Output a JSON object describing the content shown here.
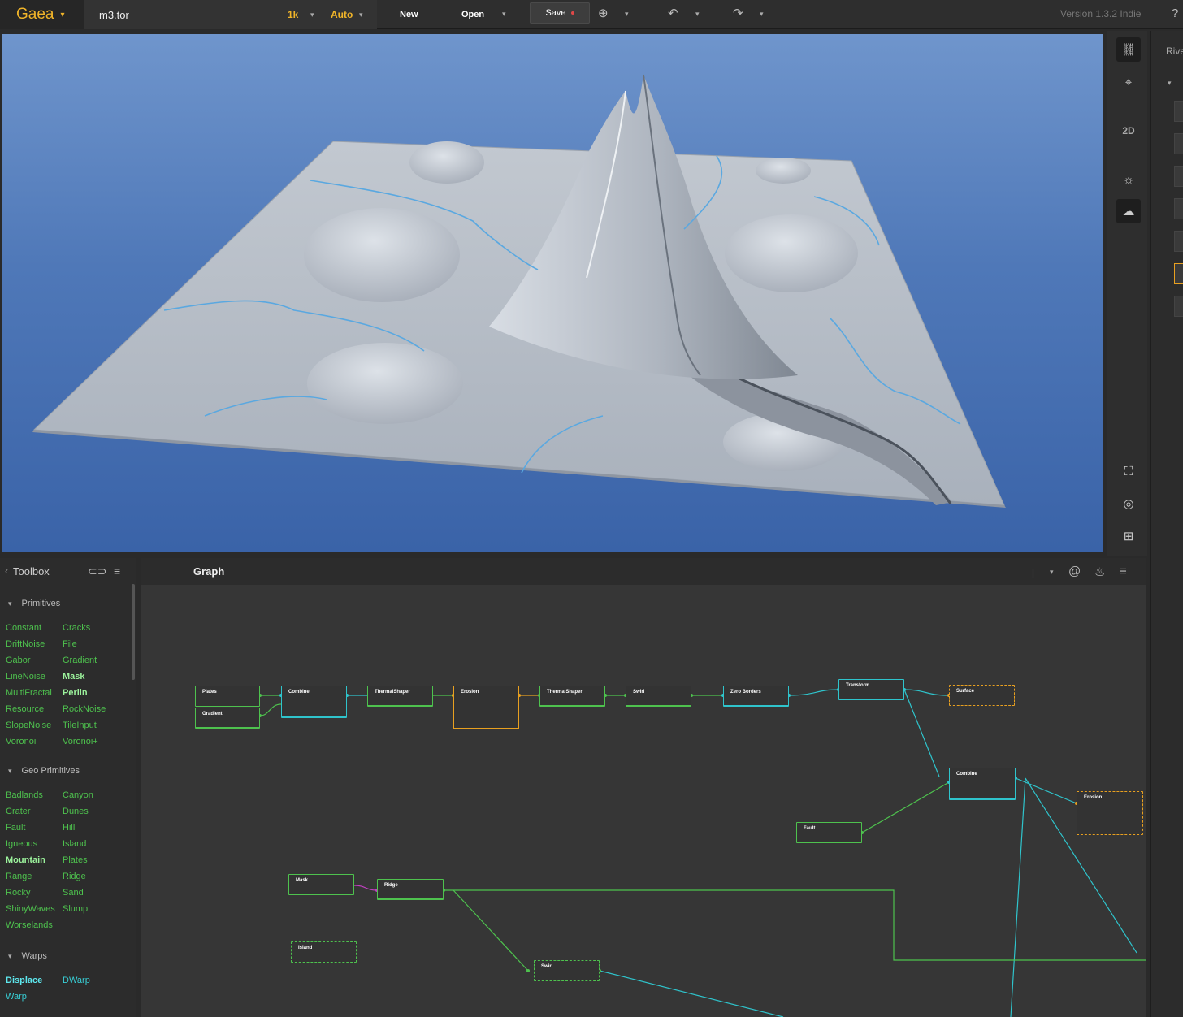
{
  "topbar": {
    "app_name": "Gaea",
    "file_name": "m3.tor",
    "resolution": "1k",
    "build_mode": "Auto",
    "new_label": "New",
    "open_label": "Open",
    "save_label": "Save",
    "version": "Version 1.3.2 Indie"
  },
  "viewport": {
    "view_toggle_label": "2D",
    "sky_color": "#5b82c0",
    "terrain_color": "#b4bcc6",
    "river_color": "#5aa8e0"
  },
  "right_panel": {
    "label": "Rive"
  },
  "toolbox": {
    "title": "Toolbox",
    "categories": [
      {
        "name": "Primitives",
        "items": [
          "Constant",
          "Cracks",
          "DriftNoise",
          "File",
          "Gabor",
          "Gradient",
          "LineNoise",
          "Mask",
          "MultiFractal",
          "Perlin",
          "Resource",
          "RockNoise",
          "SlopeNoise",
          "TileInput",
          "Voronoi",
          "Voronoi+"
        ]
      },
      {
        "name": "Geo Primitives",
        "items": [
          "Badlands",
          "Canyon",
          "Crater",
          "Dunes",
          "Fault",
          "Hill",
          "Igneous",
          "Island",
          "Mountain",
          "Plates",
          "Range",
          "Ridge",
          "Rocky",
          "Sand",
          "ShinyWaves",
          "Slump",
          "Worselands"
        ]
      },
      {
        "name": "Warps",
        "items": [
          "Displace",
          "DWarp",
          "Warp"
        ]
      }
    ],
    "highlighted": [
      "Mask",
      "Perlin",
      "Mountain",
      "Displace"
    ]
  },
  "graph": {
    "tab_label": "Graph",
    "nodes": [
      {
        "title": "Plates"
      },
      {
        "title": "Gradient"
      },
      {
        "title": "Combine"
      },
      {
        "title": "ThermalShaper"
      },
      {
        "title": "Erosion"
      },
      {
        "title": "ThermalShaper"
      },
      {
        "title": "Swirl"
      },
      {
        "title": "Zero Borders"
      },
      {
        "title": "Transform"
      },
      {
        "title": "Surface"
      },
      {
        "title": "Combine"
      },
      {
        "title": "Erosion"
      },
      {
        "title": "Fault"
      },
      {
        "title": "Mask"
      },
      {
        "title": "Ridge"
      },
      {
        "title": "Island"
      },
      {
        "title": "Swirl"
      }
    ]
  }
}
